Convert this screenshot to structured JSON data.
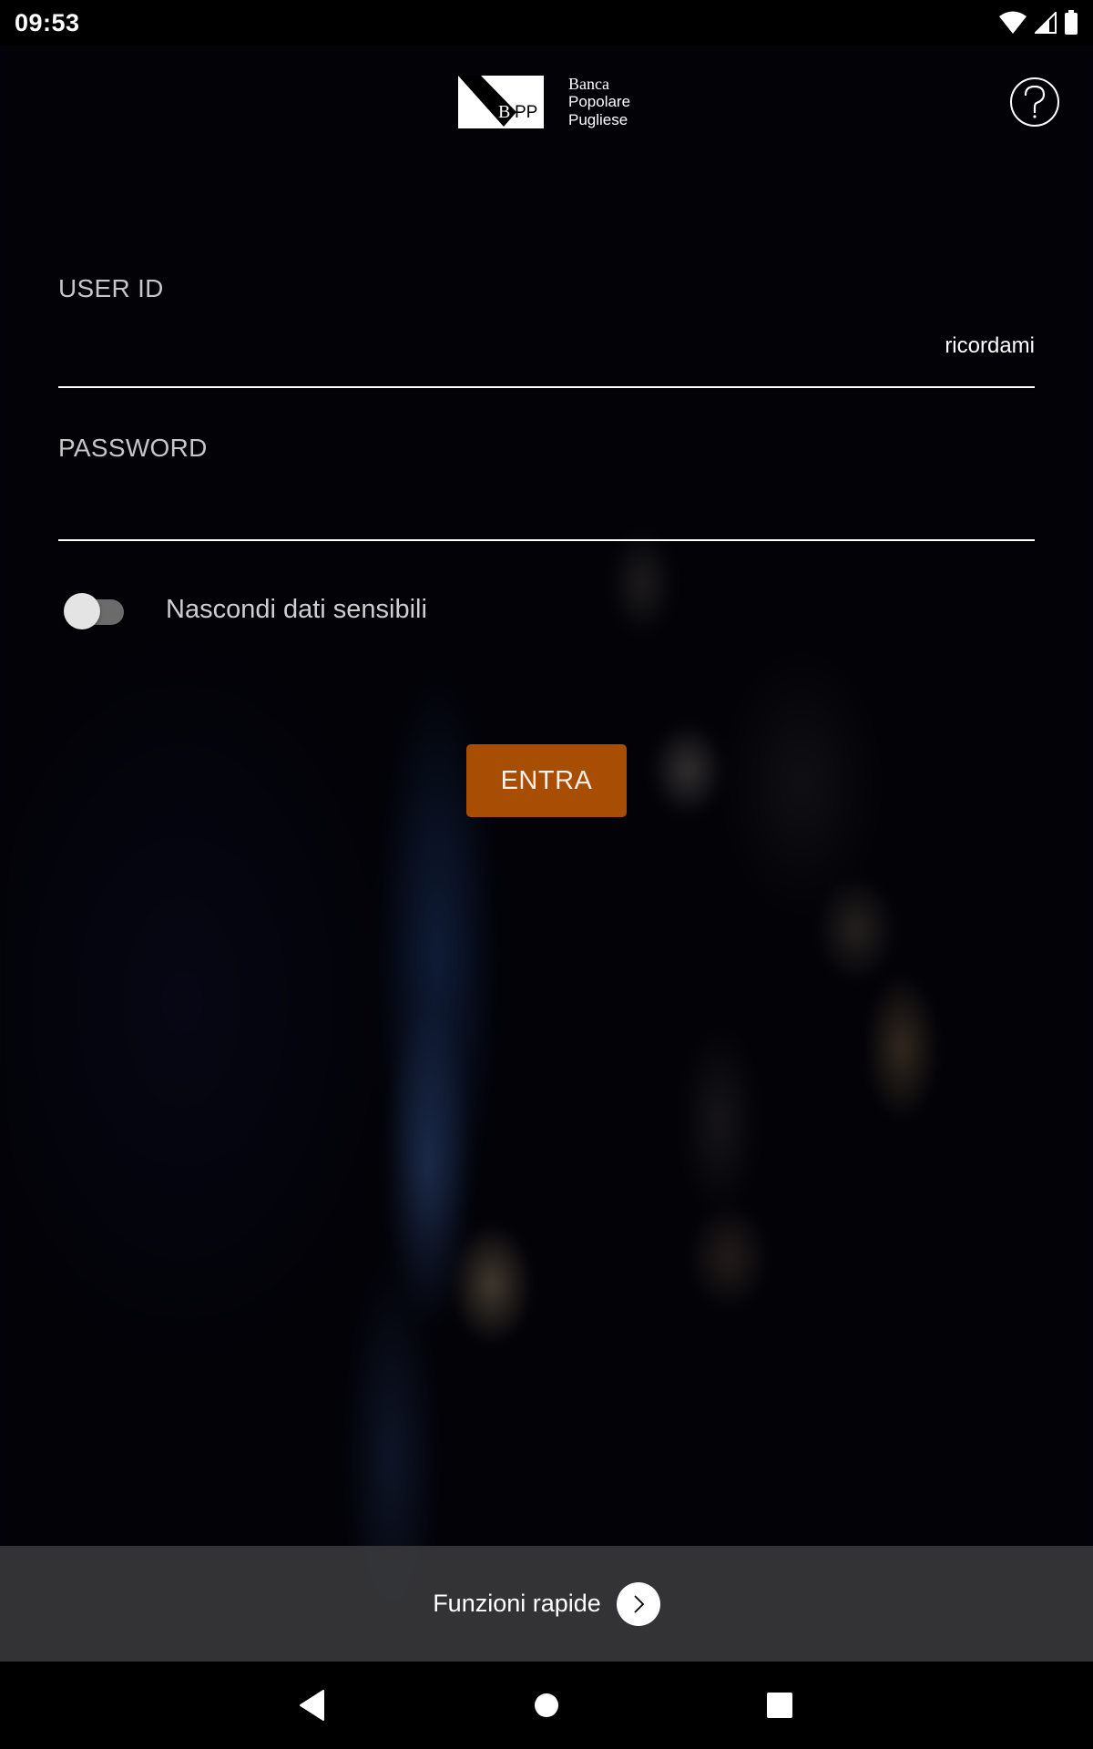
{
  "status_bar": {
    "time": "09:53",
    "icons": [
      "wifi-icon",
      "cellular-signal-icon",
      "battery-icon"
    ]
  },
  "header": {
    "logo_mark_text": "BPP",
    "logo_lines": [
      "Banca",
      "Popolare",
      "Pugliese"
    ],
    "help_icon": "question-circle-icon"
  },
  "login_form": {
    "user_id": {
      "label": "USER ID",
      "value": "",
      "placeholder": ""
    },
    "remember_label": "ricordami",
    "password": {
      "label": "PASSWORD",
      "value": "",
      "placeholder": ""
    },
    "hide_sensitive": {
      "label": "Nascondi dati sensibili",
      "checked": false
    },
    "submit_label": "ENTRA"
  },
  "quick_functions": {
    "label": "Funzioni rapide",
    "icon": "chevron-right-circle-icon"
  },
  "nav_bar": {
    "buttons": [
      "back-icon",
      "home-icon",
      "recents-icon"
    ]
  },
  "colors": {
    "accent": "#a74d04",
    "background": "#03030a",
    "quick_bar": "#3a3a3c"
  }
}
